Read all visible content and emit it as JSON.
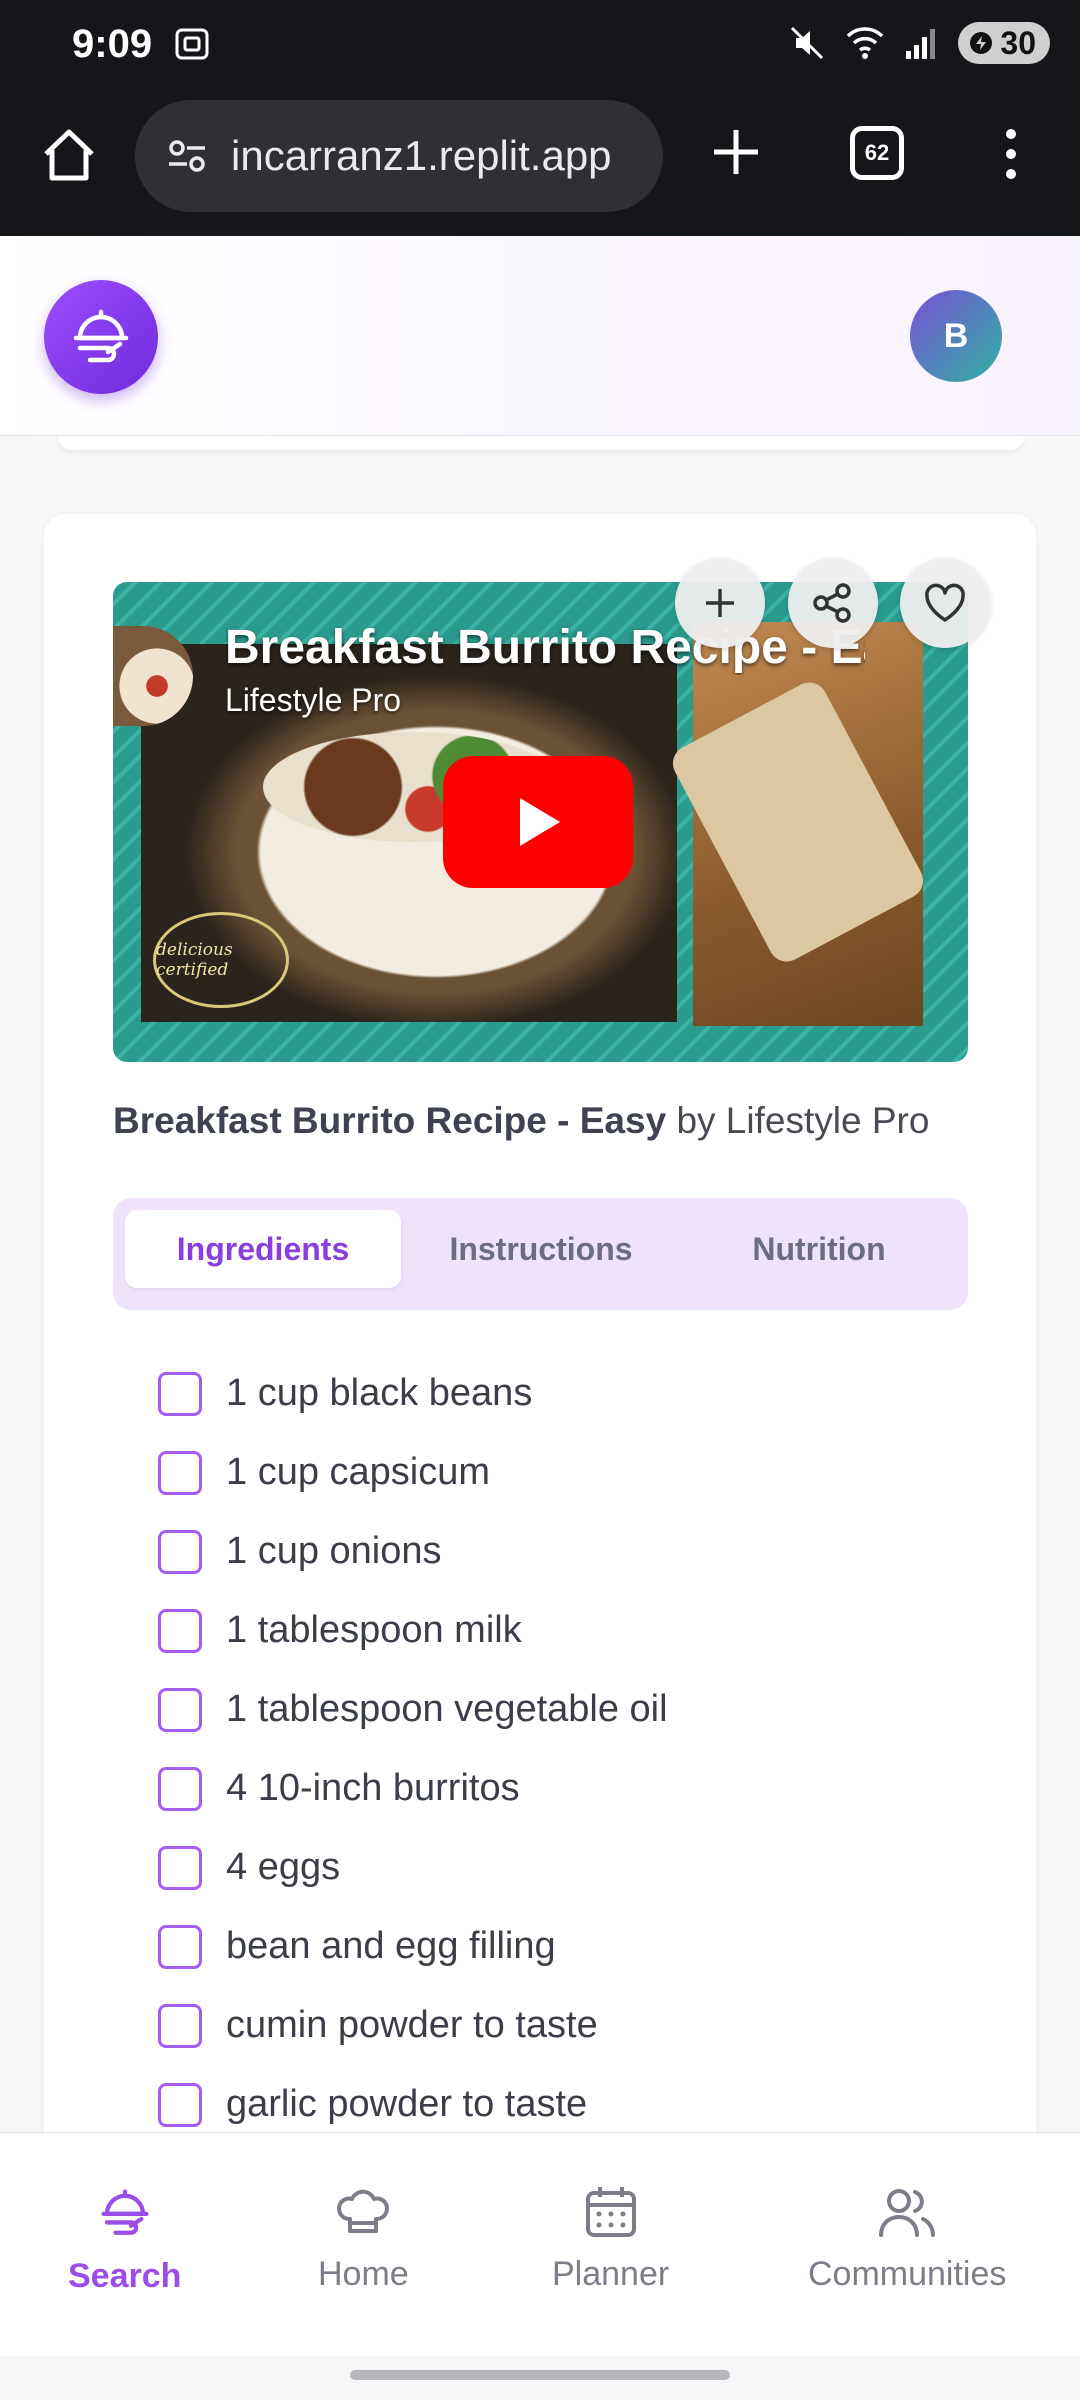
{
  "status_bar": {
    "time": "9:09",
    "battery": "30"
  },
  "browser": {
    "url": "incarranz1.replit.app",
    "tab_count": "62"
  },
  "header": {
    "avatar_initial": "B"
  },
  "video": {
    "title": "Breakfast Burrito Recipe - Easy",
    "channel": "Lifestyle Pro",
    "badge_text": "delicious certified"
  },
  "recipe": {
    "title": "Breakfast Burrito Recipe - Easy",
    "by_text": "by Lifestyle Pro"
  },
  "tabs": [
    {
      "label": "Ingredients",
      "active": true
    },
    {
      "label": "Instructions",
      "active": false
    },
    {
      "label": "Nutrition",
      "active": false
    }
  ],
  "ingredients": [
    "1 cup black beans",
    "1 cup capsicum",
    "1 cup onions",
    "1 tablespoon milk",
    "1 tablespoon vegetable oil",
    "4 10-inch burritos",
    "4 eggs",
    "bean and egg filling",
    "cumin powder to taste",
    "garlic powder to taste"
  ],
  "bottom_nav": [
    {
      "label": "Search",
      "icon": "search-dish-icon",
      "active": true
    },
    {
      "label": "Home",
      "icon": "chef-hat-icon",
      "active": false
    },
    {
      "label": "Planner",
      "icon": "calendar-icon",
      "active": false
    },
    {
      "label": "Communities",
      "icon": "users-icon",
      "active": false
    }
  ],
  "colors": {
    "accent": "#9b4de8",
    "tab_bg": "#efe3fb",
    "video_red": "#ff0000"
  }
}
